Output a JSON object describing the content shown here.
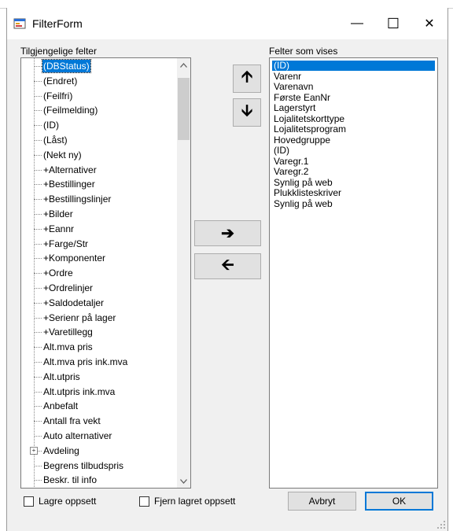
{
  "window": {
    "title": "FilterForm",
    "minimize_glyph": "—",
    "maximize_glyph": "☐",
    "close_glyph": "✕"
  },
  "left_panel": {
    "label": "Tilgjengelige felter",
    "items": [
      {
        "label": "(DBStatus)",
        "selected": true,
        "expander": false
      },
      {
        "label": "(Endret)",
        "selected": false,
        "expander": false
      },
      {
        "label": "(Feilfri)",
        "selected": false,
        "expander": false
      },
      {
        "label": "(Feilmelding)",
        "selected": false,
        "expander": false
      },
      {
        "label": "(ID)",
        "selected": false,
        "expander": false
      },
      {
        "label": "(Låst)",
        "selected": false,
        "expander": false
      },
      {
        "label": "(Nekt ny)",
        "selected": false,
        "expander": false
      },
      {
        "label": "+Alternativer",
        "selected": false,
        "expander": false
      },
      {
        "label": "+Bestillinger",
        "selected": false,
        "expander": false
      },
      {
        "label": "+Bestillingslinjer",
        "selected": false,
        "expander": false
      },
      {
        "label": "+Bilder",
        "selected": false,
        "expander": false
      },
      {
        "label": "+Eannr",
        "selected": false,
        "expander": false
      },
      {
        "label": "+Farge/Str",
        "selected": false,
        "expander": false
      },
      {
        "label": "+Komponenter",
        "selected": false,
        "expander": false
      },
      {
        "label": "+Ordre",
        "selected": false,
        "expander": false
      },
      {
        "label": "+Ordrelinjer",
        "selected": false,
        "expander": false
      },
      {
        "label": "+Saldodetaljer",
        "selected": false,
        "expander": false
      },
      {
        "label": "+Serienr på lager",
        "selected": false,
        "expander": false
      },
      {
        "label": "+Varetillegg",
        "selected": false,
        "expander": false
      },
      {
        "label": "Alt.mva pris",
        "selected": false,
        "expander": false
      },
      {
        "label": "Alt.mva pris ink.mva",
        "selected": false,
        "expander": false
      },
      {
        "label": "Alt.utpris",
        "selected": false,
        "expander": false
      },
      {
        "label": "Alt.utpris ink.mva",
        "selected": false,
        "expander": false
      },
      {
        "label": "Anbefalt",
        "selected": false,
        "expander": false
      },
      {
        "label": "Antall fra vekt",
        "selected": false,
        "expander": false
      },
      {
        "label": "Auto alternativer",
        "selected": false,
        "expander": false
      },
      {
        "label": "Avdeling",
        "selected": false,
        "expander": true
      },
      {
        "label": "Begrens tilbudspris",
        "selected": false,
        "expander": false
      },
      {
        "label": "Beskr. til info",
        "selected": false,
        "expander": false
      }
    ]
  },
  "right_panel": {
    "label": "Felter som vises",
    "items": [
      {
        "label": "(ID)",
        "selected": true
      },
      {
        "label": "Varenr",
        "selected": false
      },
      {
        "label": "Varenavn",
        "selected": false
      },
      {
        "label": "Første EanNr",
        "selected": false
      },
      {
        "label": "Lagerstyrt",
        "selected": false
      },
      {
        "label": "Lojalitetskorttype",
        "selected": false
      },
      {
        "label": "Lojalitetsprogram",
        "selected": false
      },
      {
        "label": "Hovedgruppe",
        "selected": false
      },
      {
        "label": "(ID)",
        "selected": false
      },
      {
        "label": "Varegr.1",
        "selected": false
      },
      {
        "label": "Varegr.2",
        "selected": false
      },
      {
        "label": "Synlig på web",
        "selected": false
      },
      {
        "label": "Plukklisteskriver",
        "selected": false
      },
      {
        "label": "Synlig på web",
        "selected": false
      }
    ]
  },
  "buttons": {
    "move_up": "🡩",
    "move_down": "🡫",
    "add": "➔",
    "remove": "🡨",
    "cancel": "Avbryt",
    "ok": "OK"
  },
  "checkboxes": {
    "save_layout": {
      "label": "Lagre oppsett",
      "checked": false
    },
    "remove_saved_layout": {
      "label": "Fjern lagret oppsett",
      "checked": false
    }
  },
  "colors": {
    "selection": "#0078d7",
    "dialog_bg": "#f0f0f0"
  }
}
